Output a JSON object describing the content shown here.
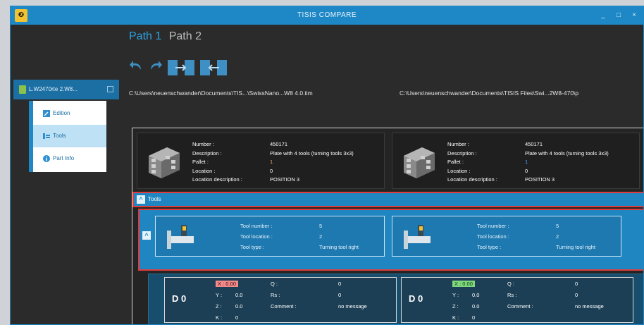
{
  "window": {
    "title": "TISIS COMPARE",
    "minimize": "_",
    "maximize": "□",
    "close": "×",
    "logo": "❷"
  },
  "path_tabs": [
    {
      "label": "Path 1",
      "active": true
    },
    {
      "label": "Path 2",
      "active": false
    }
  ],
  "toolbar": {
    "undo_icon": "undo-icon",
    "redo_icon": "redo-icon",
    "copy_right_icon": "copy-right-icon",
    "copy_left_icon": "copy-left-icon"
  },
  "sidebar": {
    "file_label": "L.W2470rte 2.W8...",
    "menu": [
      {
        "label": "Edition",
        "icon": "edit-icon"
      },
      {
        "label": "Tools",
        "icon": "tools-icon",
        "selected": true
      },
      {
        "label": "Part Info",
        "icon": "info-icon"
      }
    ]
  },
  "paths": {
    "left": "C:\\Users\\neuenschwander\\Documents\\TIS...\\SwissNano...W8 4.0.tim",
    "right": "C:\\Users\\neuenschwander\\Documents\\TISIS Files\\Swi...2W8-470\\p"
  },
  "pallets": [
    {
      "labels": {
        "number": "Number :",
        "description": "Description :",
        "pallet": "Pallet :",
        "location": "Location :",
        "location_description": "Location description :"
      },
      "values": {
        "number": "450171",
        "description": "Plate with 4 tools (turning tools 3x3)",
        "pallet": "1",
        "location": "0",
        "location_description": "POSITION 3"
      }
    },
    {
      "labels": {
        "number": "Number :",
        "description": "Description :",
        "pallet": "Pallet :",
        "location": "Location :",
        "location_description": "Location description :"
      },
      "values": {
        "number": "450171",
        "description": "Plate with 4 tools (turning tools 3x3)",
        "pallet": "1",
        "location": "0",
        "location_description": "POSITION 3"
      }
    }
  ],
  "section": {
    "label": "Tools"
  },
  "tools": [
    {
      "labels": {
        "tool_number": "Tool number :",
        "tool_location": "Tool location :",
        "tool_type": "Tool type :"
      },
      "values": {
        "tool_number": "5",
        "tool_location": "2",
        "tool_type": "Turning tool right"
      }
    },
    {
      "labels": {
        "tool_number": "Tool number :",
        "tool_location": "Tool location :",
        "tool_type": "Tool type :"
      },
      "values": {
        "tool_number": "5",
        "tool_location": "2",
        "tool_type": "Turning tool right"
      }
    }
  ],
  "offsets": [
    {
      "title": "D 0",
      "highlight": "#f28a8a",
      "labels": {
        "x": "X :",
        "y": "Y :",
        "z": "Z :",
        "k": "K :",
        "q": "Q :",
        "rs": "Rs :",
        "comment": "Comment :"
      },
      "values": {
        "x": "0.00",
        "y": "0.0",
        "z": "0.0",
        "k": "0",
        "q": "0",
        "rs": "0",
        "comment": "no message"
      }
    },
    {
      "title": "D 0",
      "highlight": "#7fd87f",
      "labels": {
        "x": "X :",
        "y": "Y :",
        "z": "Z :",
        "k": "K :",
        "q": "Q :",
        "rs": "Rs :",
        "comment": "Comment :"
      },
      "values": {
        "x": "0.00",
        "y": "0.0",
        "z": "0.0",
        "k": "0",
        "q": "0",
        "rs": "0",
        "comment": "no message"
      }
    }
  ]
}
